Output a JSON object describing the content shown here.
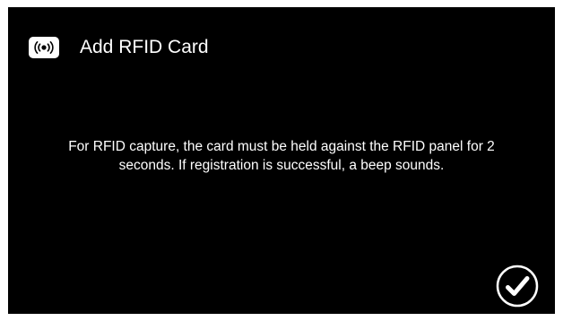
{
  "header": {
    "icon": "rfid-icon",
    "title": "Add RFID Card"
  },
  "main": {
    "message": "For RFID capture, the card must be held against the RFID panel for 2 seconds. If registration is successful, a beep sounds."
  },
  "footer": {
    "confirm_icon": "checkmark-icon"
  },
  "colors": {
    "background": "#000000",
    "foreground": "#ffffff",
    "frame": "#ffffff"
  }
}
